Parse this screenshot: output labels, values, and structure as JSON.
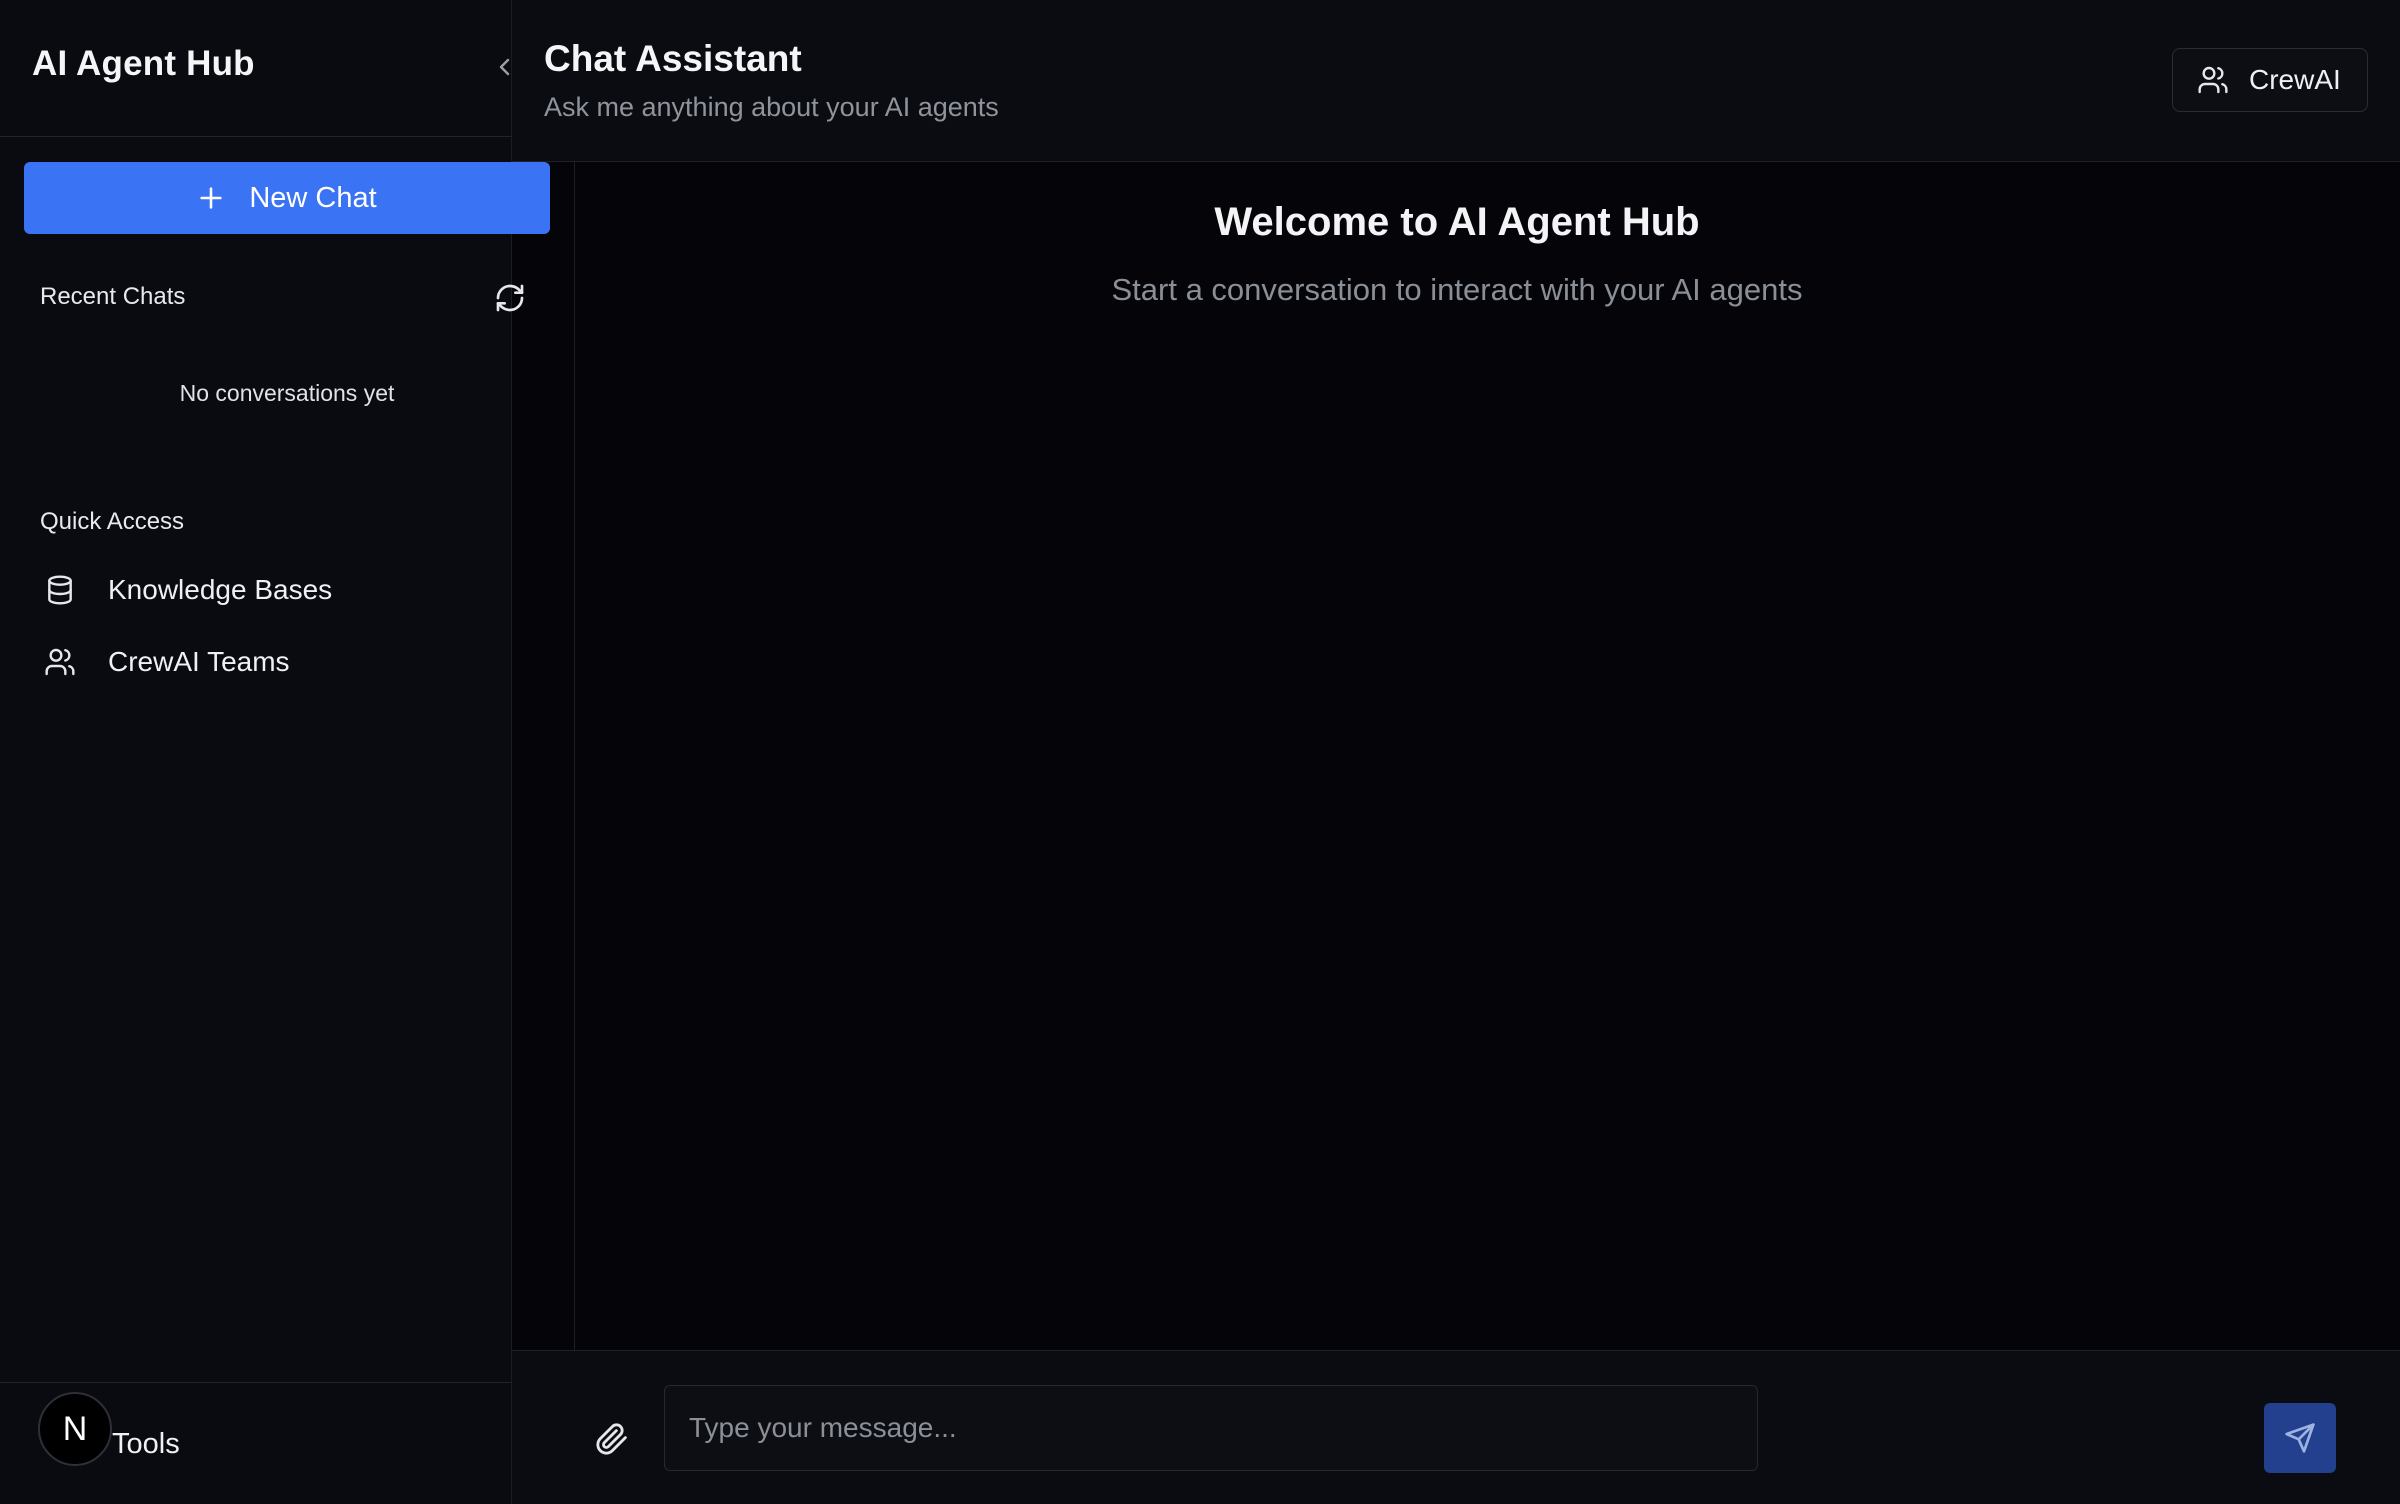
{
  "sidebar": {
    "app_title": "AI Agent Hub",
    "new_chat_label": "New Chat",
    "recent_chats_label": "Recent Chats",
    "empty_state": "No conversations yet",
    "quick_access_label": "Quick Access",
    "quick_access": [
      {
        "label": "Knowledge Bases",
        "icon": "database-icon"
      },
      {
        "label": "CrewAI Teams",
        "icon": "users-icon"
      }
    ],
    "footer": {
      "avatar_letter": "N",
      "tools_label": "Tools"
    }
  },
  "header": {
    "title": "Chat Assistant",
    "subtitle": "Ask me anything about your AI agents",
    "mode_button_label": "CrewAI"
  },
  "chat": {
    "welcome_title": "Welcome to AI Agent Hub",
    "welcome_subtitle": "Start a conversation to interact with your AI agents"
  },
  "composer": {
    "placeholder": "Type your message..."
  },
  "colors": {
    "accent": "#3b73f5",
    "send_button": "#22408e",
    "background": "#050509",
    "sidebar": "#0a0b10"
  }
}
